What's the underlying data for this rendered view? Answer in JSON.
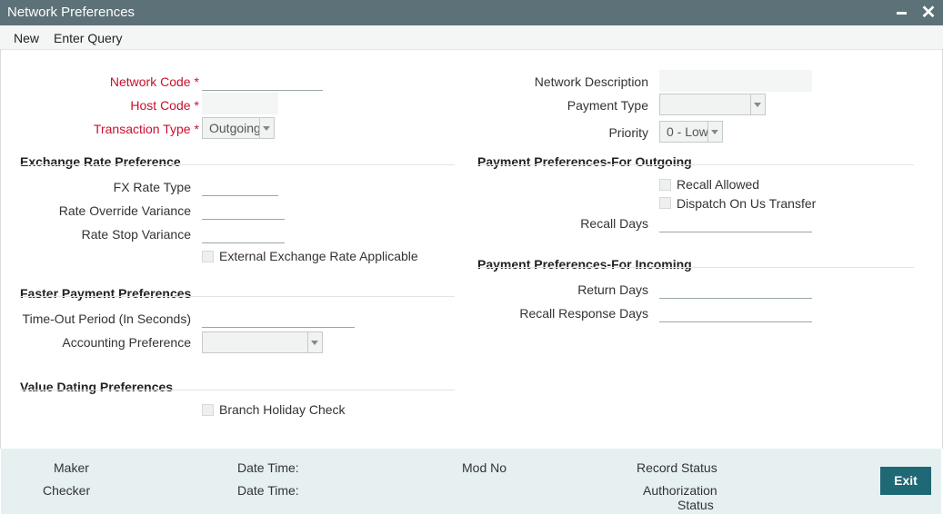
{
  "window": {
    "title": "Network Preferences"
  },
  "menu": {
    "new_label": "New",
    "enter_query_label": "Enter Query"
  },
  "form": {
    "network_code_label": "Network Code",
    "host_code_label": "Host Code",
    "transaction_type_label": "Transaction Type",
    "transaction_type_value": "Outgoing",
    "required_marker": "*",
    "network_description_label": "Network Description",
    "payment_type_label": "Payment Type",
    "payment_type_value": "",
    "priority_label": "Priority",
    "priority_value": "0 - Low"
  },
  "exchange_rate": {
    "heading": "Exchange Rate Preference",
    "fx_rate_type_label": "FX Rate Type",
    "rate_override_label": "Rate Override Variance",
    "rate_stop_label": "Rate Stop Variance",
    "external_rate_label": "External Exchange Rate Applicable"
  },
  "faster_payment": {
    "heading": "Faster Payment Preferences",
    "timeout_label": "Time-Out Period (In Seconds)",
    "accounting_label": "Accounting Preference",
    "accounting_value": ""
  },
  "value_dating": {
    "heading": "Value Dating Preferences",
    "branch_holiday_label": "Branch Holiday Check"
  },
  "outgoing": {
    "heading": "Payment Preferences-For Outgoing",
    "recall_allowed_label": "Recall Allowed",
    "dispatch_label": "Dispatch On Us Transfer",
    "recall_days_label": "Recall Days"
  },
  "incoming": {
    "heading": "Payment Preferences-For Incoming",
    "return_days_label": "Return Days",
    "recall_response_label": "Recall Response Days"
  },
  "footer": {
    "maker_label": "Maker",
    "checker_label": "Checker",
    "date_time_label_1": "Date Time:",
    "date_time_label_2": "Date Time:",
    "mod_no_label": "Mod No",
    "record_status_label": "Record Status",
    "authorization_label": "Authorization",
    "status_label": "Status",
    "exit_label": "Exit"
  },
  "colors": {
    "titlebar": "#5c7178",
    "required": "#c8102e",
    "exit_button": "#1f6875",
    "footer": "#e6f0f1"
  }
}
